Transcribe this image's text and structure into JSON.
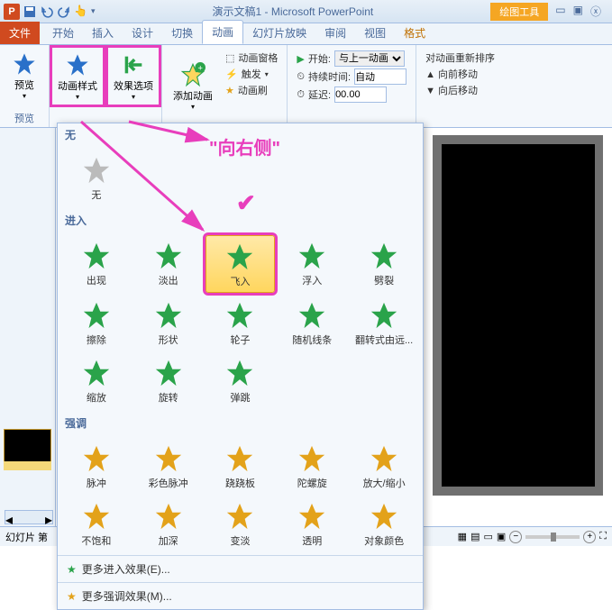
{
  "title": "演示文稿1 - Microsoft PowerPoint",
  "contextual": "绘图工具",
  "qat": {
    "save": "save-icon",
    "undo": "undo-icon",
    "redo": "redo-icon"
  },
  "tabs": {
    "file": "文件",
    "home": "开始",
    "insert": "插入",
    "design": "设计",
    "transition": "切换",
    "animation": "动画",
    "slideshow": "幻灯片放映",
    "review": "审阅",
    "view": "视图",
    "format": "格式"
  },
  "ribbon": {
    "preview": "预览",
    "anim_style": "动画样式",
    "effect_options": "效果选项",
    "add_anim": "添加动画",
    "anim_pane": "动画窗格",
    "trigger": "触发",
    "anim_painter": "动画刷",
    "start_label": "开始:",
    "start_value": "与上一动画...",
    "duration_label": "持续时间:",
    "duration_value": "自动",
    "delay_label": "延迟:",
    "delay_value": "00.00",
    "reorder_title": "对动画重新排序",
    "move_earlier": "向前移动",
    "move_later": "向后移动"
  },
  "gallery": {
    "none_section": "无",
    "none": "无",
    "entrance_section": "进入",
    "entrance": [
      "出现",
      "淡出",
      "飞入",
      "浮入",
      "劈裂",
      "擦除",
      "形状",
      "轮子",
      "随机线条",
      "翻转式由远...",
      "缩放",
      "旋转",
      "弹跳"
    ],
    "emphasis_section": "强调",
    "emphasis": [
      "脉冲",
      "彩色脉冲",
      "跷跷板",
      "陀螺旋",
      "放大/缩小",
      "不饱和",
      "加深",
      "变淡",
      "透明",
      "对象颜色"
    ],
    "more_entrance": "更多进入效果(E)...",
    "more_emphasis": "更多强调效果(M)..."
  },
  "annotation": {
    "direction": "\"向右侧\""
  },
  "status": {
    "slide": "幻灯片 第"
  }
}
